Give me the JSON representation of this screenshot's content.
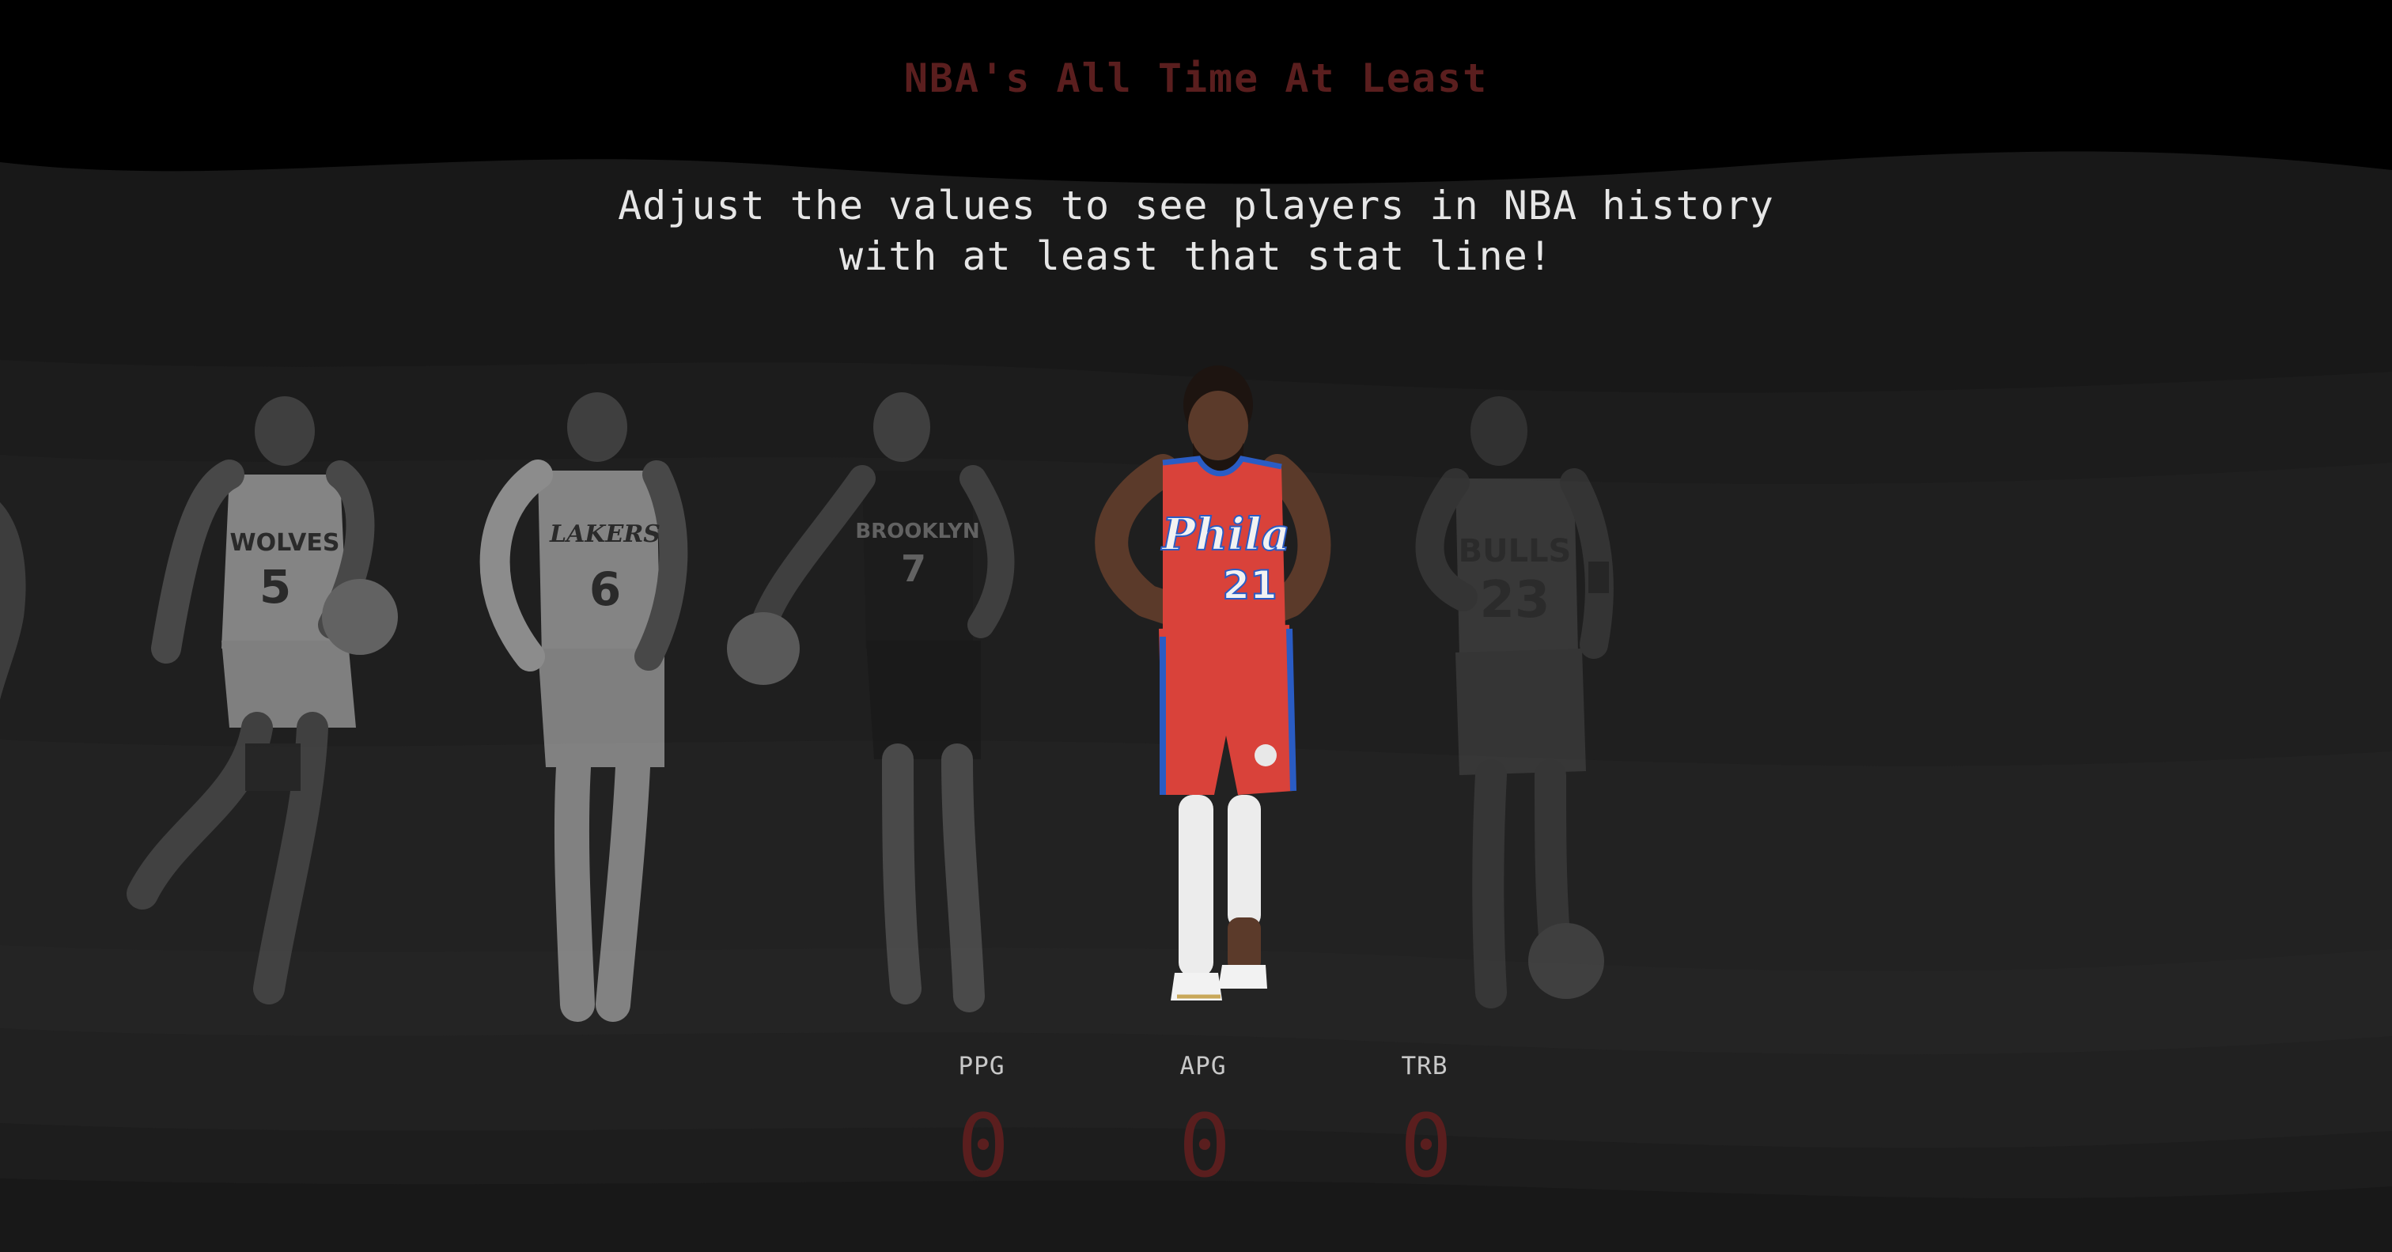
{
  "header": {
    "title": "NBA's All Time At Least"
  },
  "intro": {
    "line1": "Adjust the values to see players in NBA history",
    "line2": "with at least that stat line!"
  },
  "players": [
    {
      "jersey_text": "WOLVES",
      "number": "5",
      "selected": false
    },
    {
      "jersey_text": "LAKERS",
      "number": "6",
      "selected": false
    },
    {
      "jersey_text": "BROOKLYN",
      "number": "7",
      "selected": false
    },
    {
      "jersey_text": "Phila",
      "number": "21",
      "selected": true
    },
    {
      "jersey_text": "BULLS",
      "number": "23",
      "selected": false
    }
  ],
  "stats": {
    "ppg": {
      "label": "PPG",
      "value": "0"
    },
    "apg": {
      "label": "APG",
      "value": "0"
    },
    "trb": {
      "label": "TRB",
      "value": "0"
    }
  },
  "colors": {
    "title": "#5a1e1e",
    "value": "#5a1e1e",
    "selected_jersey": "#d9423a",
    "selected_trim": "#2a5cc4"
  }
}
